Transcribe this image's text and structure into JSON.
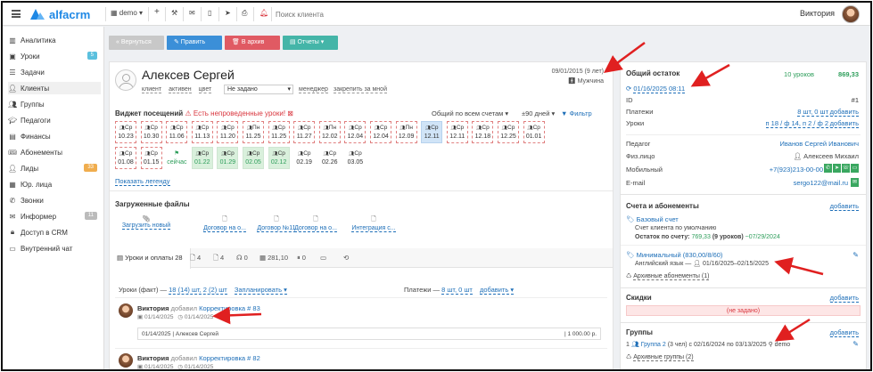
{
  "brand": {
    "name": "alfacrm",
    "accent": "#1e88e5"
  },
  "topbar": {
    "branch": "demo",
    "plus": "+",
    "search_placeholder": "Поиск клиента",
    "user_name": "Виктория"
  },
  "sidebar": {
    "items": [
      {
        "label": "Аналитика",
        "icon": "chart-icon"
      },
      {
        "label": "Уроки",
        "icon": "calendar-icon",
        "badge": "5",
        "badge_color": "#5bc0de"
      },
      {
        "label": "Задачи",
        "icon": "tasks-icon"
      },
      {
        "label": "Клиенты",
        "icon": "user-icon",
        "active": true
      },
      {
        "label": "Группы",
        "icon": "group-icon"
      },
      {
        "label": "Педагоги",
        "icon": "teacher-icon"
      },
      {
        "label": "Финансы",
        "icon": "finance-icon"
      },
      {
        "label": "Абонементы",
        "icon": "ticket-icon"
      },
      {
        "label": "Лиды",
        "icon": "leads-icon",
        "badge": "33",
        "badge_color": "#f0ad4e"
      },
      {
        "label": "Юр. лица",
        "icon": "building-icon"
      },
      {
        "label": "Звонки",
        "icon": "phone-icon"
      },
      {
        "label": "Информер",
        "icon": "bell-icon",
        "badge": "11",
        "badge_color": "#bbbbbb"
      },
      {
        "label": "Доступ в CRM",
        "icon": "lock-icon"
      },
      {
        "label": "Внутренний чат",
        "icon": "chat-icon"
      }
    ]
  },
  "toolbar": {
    "back": "« Вернуться",
    "edit": "✎ Править",
    "archive": "🗑 В архив",
    "reports": "▤ Отчеты ▾"
  },
  "client": {
    "name": "Алексев Сергей",
    "tags": [
      "клиент",
      "активен",
      "цвет"
    ],
    "status_select": "Не задано",
    "manager_label": "менеджер",
    "assign_link": "закрепить за мной",
    "birth": "09/01/2015 (9 лет)",
    "gender": "Мужчина"
  },
  "widget": {
    "title": "Виджет посещений",
    "warning": "Есть непроведенные уроки!",
    "account_filter": "Общий по всем счетам",
    "days_filter": "±90 дней",
    "filter_label": "Фильтр",
    "row1": [
      {
        "w": "Ср",
        "d": "10.23",
        "s": "past"
      },
      {
        "w": "Ср",
        "d": "10.30",
        "s": "past"
      },
      {
        "w": "Ср",
        "d": "11.06",
        "s": "past"
      },
      {
        "w": "Ср",
        "d": "11.13",
        "s": "past"
      },
      {
        "w": "Ср",
        "d": "11.20",
        "s": "past"
      },
      {
        "w": "Пн",
        "d": "11.25",
        "s": "past"
      },
      {
        "w": "Ср",
        "d": "11.25",
        "s": "past"
      },
      {
        "w": "Ср",
        "d": "11.27",
        "s": "past"
      },
      {
        "w": "Пн",
        "d": "12.02",
        "s": "past"
      },
      {
        "w": "Ср",
        "d": "12.04",
        "s": "past"
      },
      {
        "w": "Ср",
        "d": "12.04",
        "s": "past"
      },
      {
        "w": "Пн",
        "d": "12.09",
        "s": "past"
      },
      {
        "w": "Ср",
        "d": "12.11",
        "s": "today"
      },
      {
        "w": "Ср",
        "d": "12.11",
        "s": "past"
      },
      {
        "w": "Ср",
        "d": "12.18",
        "s": "past"
      },
      {
        "w": "Ср",
        "d": "12.25",
        "s": "past"
      },
      {
        "w": "Ср",
        "d": "01.01",
        "s": "past"
      }
    ],
    "row2": [
      {
        "w": "Ср",
        "d": "01.08",
        "s": "past"
      },
      {
        "w": "Ср",
        "d": "01.15",
        "s": "past"
      },
      {
        "w": "",
        "d": "сейчас",
        "s": "now"
      },
      {
        "w": "Ср",
        "d": "01.22",
        "s": "done"
      },
      {
        "w": "Ср",
        "d": "01.29",
        "s": "done"
      },
      {
        "w": "Ср",
        "d": "02.05",
        "s": "done"
      },
      {
        "w": "Ср",
        "d": "02.12",
        "s": "done"
      },
      {
        "w": "Ср",
        "d": "02.19",
        "s": "plain"
      },
      {
        "w": "Ср",
        "d": "02.26",
        "s": "plain"
      },
      {
        "w": "Ср",
        "d": "03.05",
        "s": "plain"
      }
    ],
    "legend_link": "Показать легенду"
  },
  "files": {
    "title": "Загруженные файлы",
    "items": [
      "Загрузить новый",
      "Договор на о...",
      "Договор №11",
      "Договор на о...",
      "Интеграция с..."
    ]
  },
  "tabs": [
    {
      "label": "Уроки и оплаты 28",
      "icon": "list-icon",
      "active": true
    },
    {
      "label": "4",
      "icon": "doc-icon"
    },
    {
      "label": "4",
      "icon": "doc-icon"
    },
    {
      "label": "0",
      "icon": "mic-icon"
    },
    {
      "label": "281,10",
      "icon": "coins-icon"
    },
    {
      "label": "0",
      "icon": "pause-icon"
    },
    {
      "label": "",
      "icon": "sms-icon"
    },
    {
      "label": "",
      "icon": "history-icon"
    }
  ],
  "lessons": {
    "fact_label": "Уроки (факт) —",
    "fact_link": "18 (14) шт, 2 (2) шт",
    "plan_link": "Запланировать ▾",
    "payments_label": "Платежи —",
    "payments_link": "8 шт, 0 шт",
    "add_link": "добавить ▾",
    "entries": [
      {
        "author": "Виктория",
        "action": "добавил",
        "target": "Корректировка # 83",
        "date1": "01/14/2025",
        "date2": "01/14/2025",
        "detail_date": "01/14/2025",
        "detail_name": "Алексев Сергей",
        "amount": "1 000.00 р."
      },
      {
        "author": "Виктория",
        "action": "добавил",
        "target": "Корректировка # 82",
        "date1": "01/14/2025",
        "date2": "01/14/2025"
      }
    ]
  },
  "balance": {
    "title": "Общий остаток",
    "lessons": "10 уроков",
    "amount": "869,33",
    "date_link": "01/16/2025 08:11",
    "id_label": "ID",
    "id_value": "#1",
    "payments_label": "Платежи",
    "payments_value": "8 шт, 0 шт",
    "lessons_label": "Уроки",
    "lessons_value": "п 18 / ф 14, п 2 / ф 2",
    "add": "добавить",
    "teacher_label": "Педагог",
    "teacher_value": "Иванов Сергей Иванович",
    "person_label": "Физ.лицо",
    "person_value": "Алексеев Михаил",
    "phone_label": "Мобильный",
    "phone_value": "+7(923)213-00-00",
    "email_label": "E-mail",
    "email_value": "sergo122@mail.ru"
  },
  "accounts": {
    "title": "Счета и абонементы",
    "add": "добавить",
    "base_title": "Базовый счет",
    "base_desc": "Счет клиента по умолчанию",
    "base_remaining": "Остаток по счету:",
    "base_value": "769,33",
    "base_lessons": "(9 уроков)",
    "base_date": "~07/29/2024",
    "sub_title": "Минимальный (830,00/8/60)",
    "sub_desc": "Английский язык — ",
    "sub_range": "01/16/2025–02/15/2025",
    "archive": "Архивные абонементы (1)"
  },
  "discounts": {
    "title": "Скидки",
    "add": "добавить",
    "empty": "(не задано)"
  },
  "groups": {
    "title": "Группы",
    "add": "добавить",
    "item_prefix": "1",
    "item_link": "Группа 2",
    "item_rest": "(3 чел) с 02/16/2024 по 03/13/2025",
    "item_branch": "demo",
    "archive": "Архивные группы (2)"
  }
}
